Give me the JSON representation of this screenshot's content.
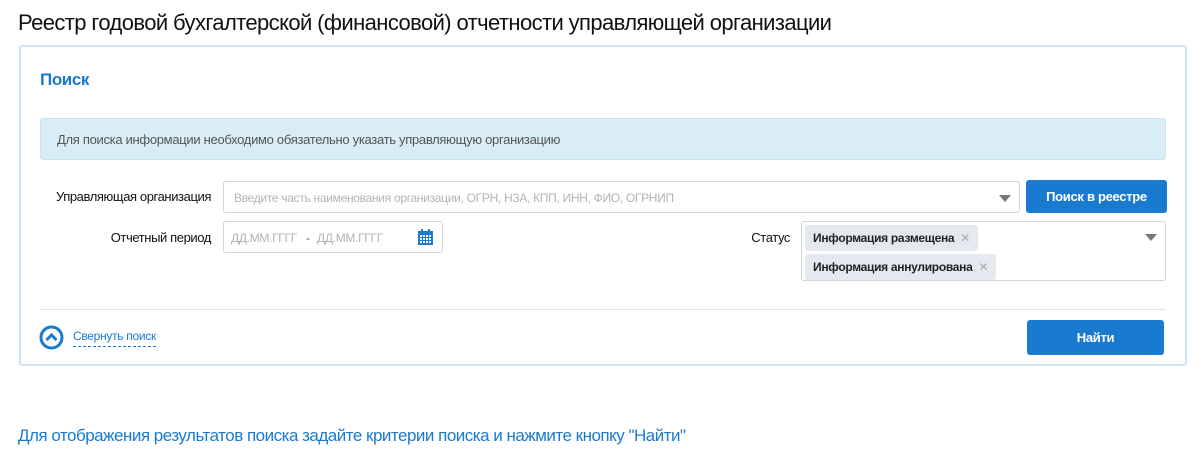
{
  "page_title": "Реестр годовой бухгалтерской (финансовой) отчетности управляющей организации",
  "search": {
    "title": "Поиск",
    "info": "Для поиска информации необходимо обязательно указать управляющую организацию",
    "org_label": "Управляющая организация",
    "org_placeholder": "Введите часть наименования организации, ОГРН, НЗА, КПП, ИНН, ФИО, ОГРНИП",
    "registry_button": "Поиск в реестре",
    "period_label": "Отчетный период",
    "date_from_placeholder": "ДД.ММ.ГГГГ",
    "date_separator": "-",
    "date_to_placeholder": "ДД.ММ.ГГГГ",
    "status_label": "Статус",
    "status_tags": [
      "Информация размещена",
      "Информация аннулирована"
    ],
    "collapse_link": "Свернуть поиск",
    "find_button": "Найти"
  },
  "results_hint": "Для отображения результатов поиска задайте критерии поиска и нажмите кнопку \"Найти\"",
  "colors": {
    "accent": "#1a7ad0",
    "info_bg": "#d9edf7"
  }
}
